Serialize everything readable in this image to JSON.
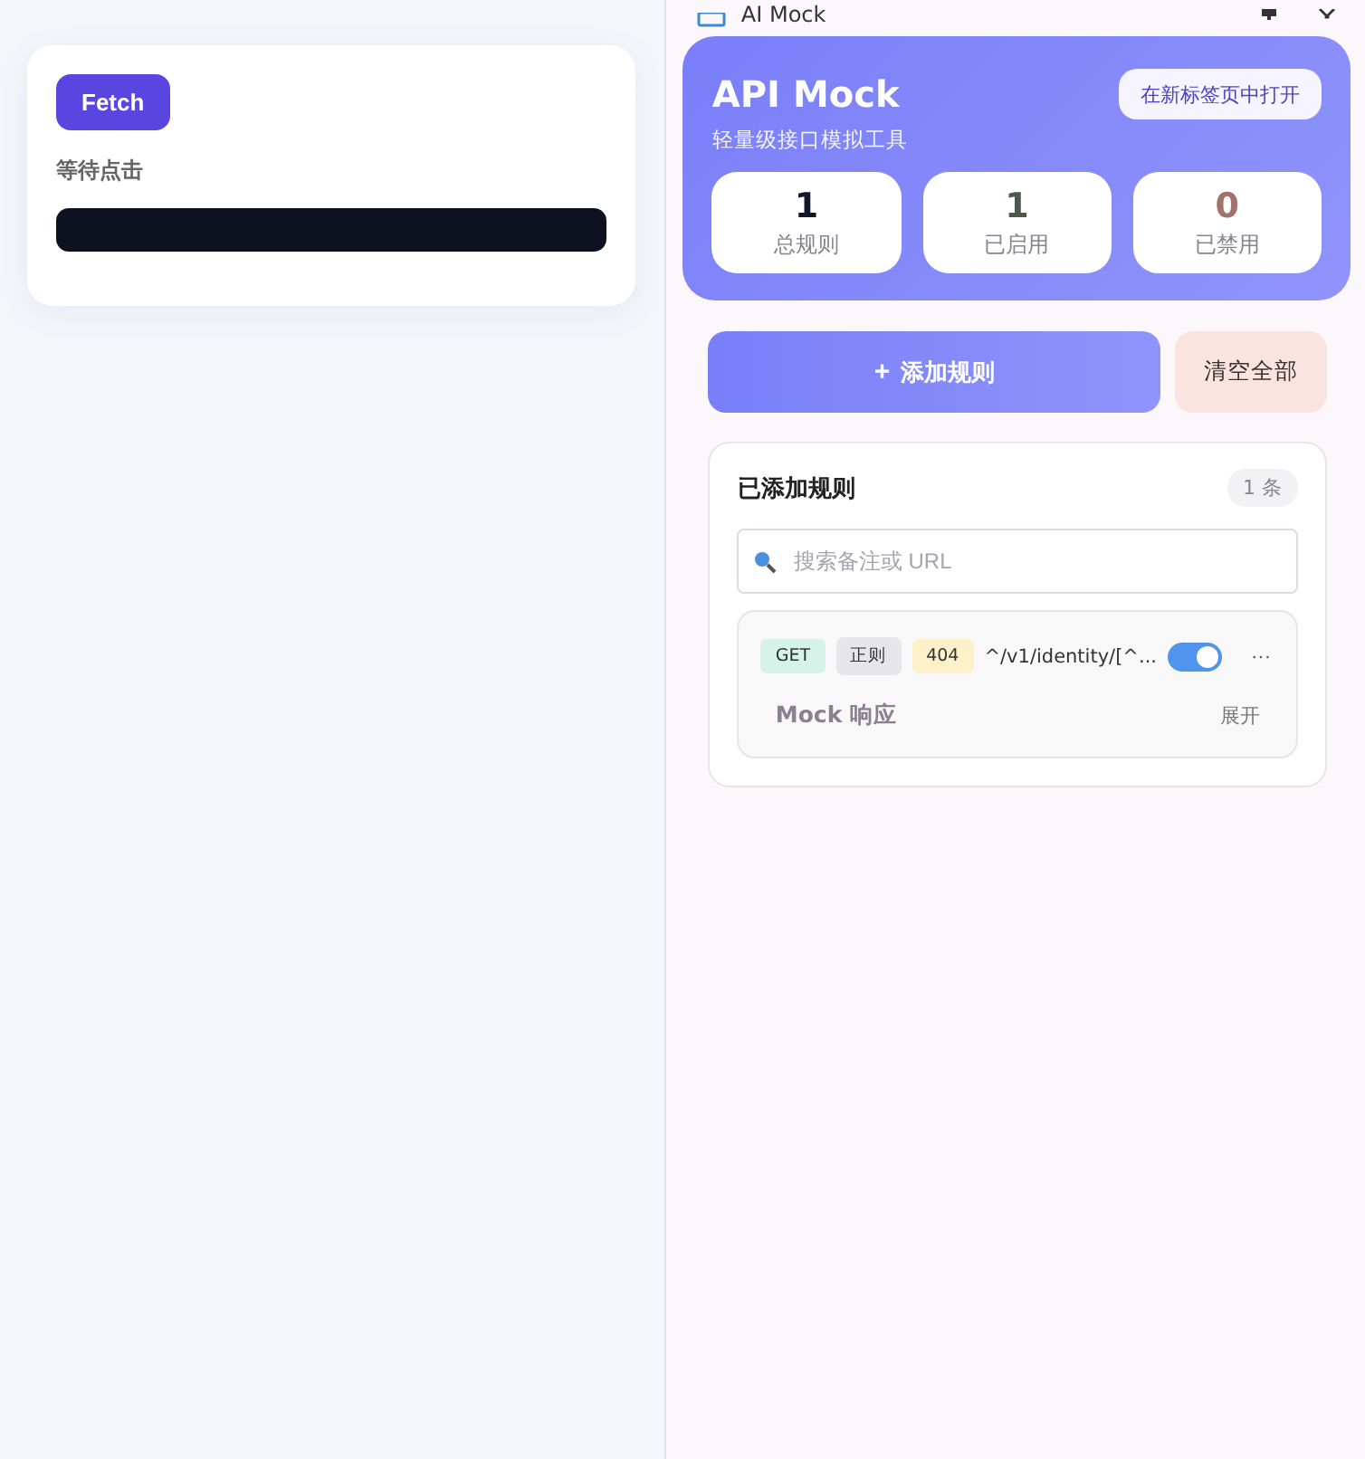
{
  "demo": {
    "button": "Fetch",
    "status": "等待点击"
  },
  "panel": {
    "title": "AI Mock",
    "header": {
      "title": "API Mock",
      "subtitle": "轻量级接口模拟工具",
      "open_button": "在新标签页中打开"
    },
    "stats": [
      {
        "value": "1",
        "label": "总规则",
        "color": "#111827"
      },
      {
        "value": "1",
        "label": "已启用",
        "color": "#4b5a4b"
      },
      {
        "value": "0",
        "label": "已禁用",
        "color": "#a0736b"
      }
    ],
    "actions": {
      "add": "添加规则",
      "add_icon": "+",
      "clear": "清空全部"
    },
    "rules": {
      "title": "已添加规则",
      "count": "1 条",
      "search": {
        "placeholder": "搜索备注或 URL"
      },
      "items": [
        {
          "method": "GET",
          "match": "正则",
          "status": "404",
          "url": "^/v1/identity/[^...",
          "on": true,
          "response_label": "Mock 响应",
          "expand": "展开",
          "more": "···"
        }
      ]
    }
  }
}
